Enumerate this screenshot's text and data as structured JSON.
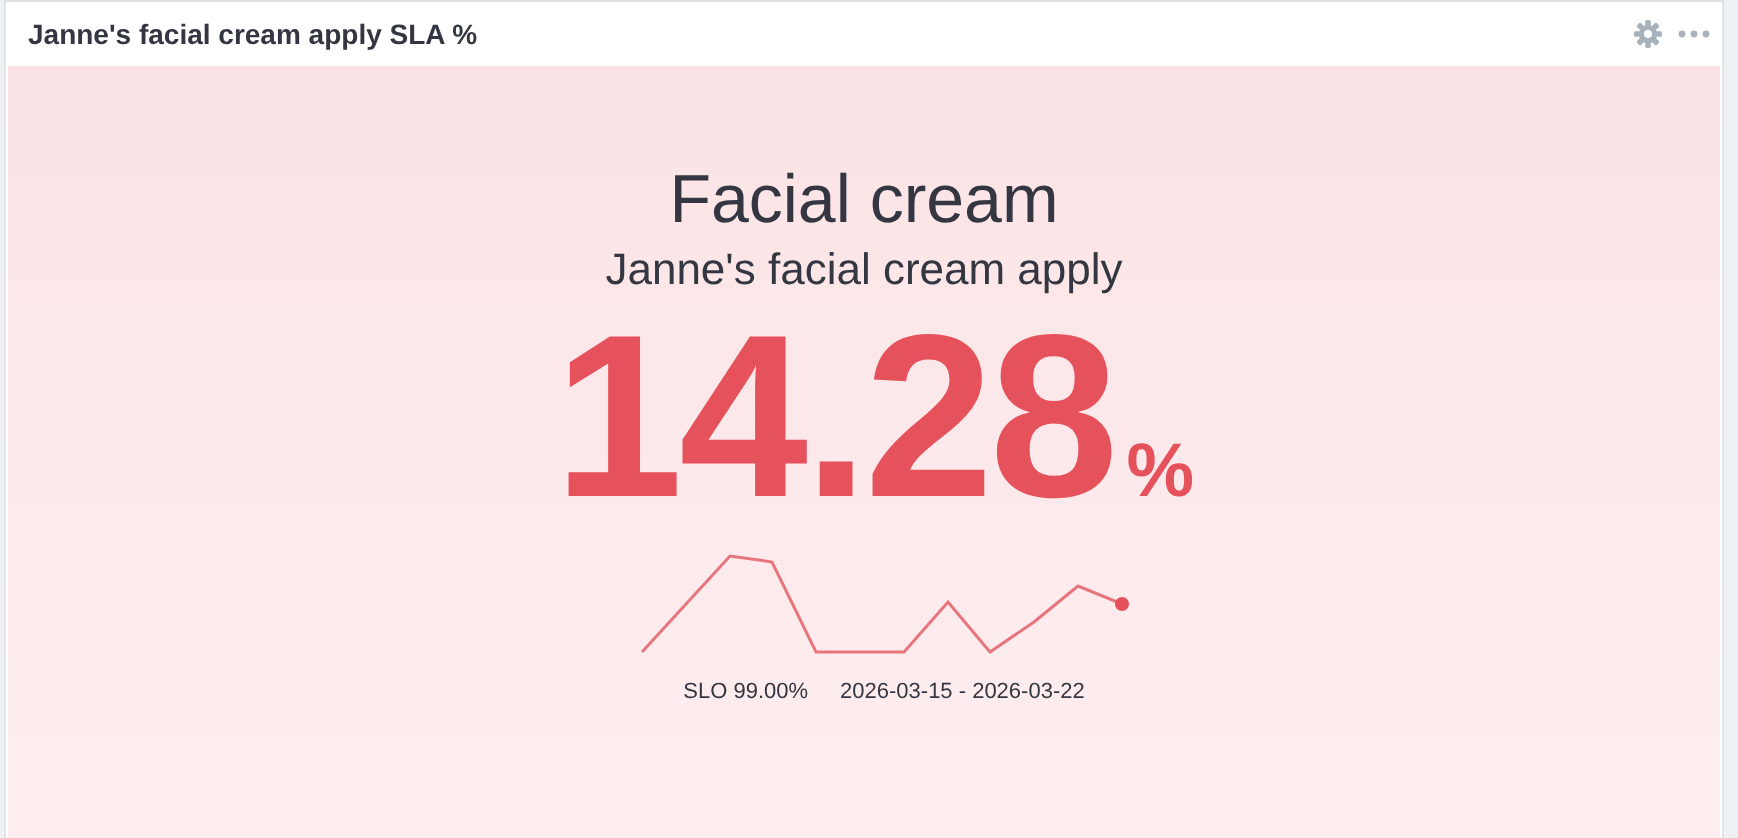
{
  "panel": {
    "title": "Janne's facial cream apply SLA %"
  },
  "stat": {
    "title": "Facial cream",
    "subtitle": "Janne's facial cream apply",
    "value": "14.28",
    "unit": "%",
    "slo": "SLO 99.00%",
    "range": "2026-03-15 - 2026-03-22"
  }
}
